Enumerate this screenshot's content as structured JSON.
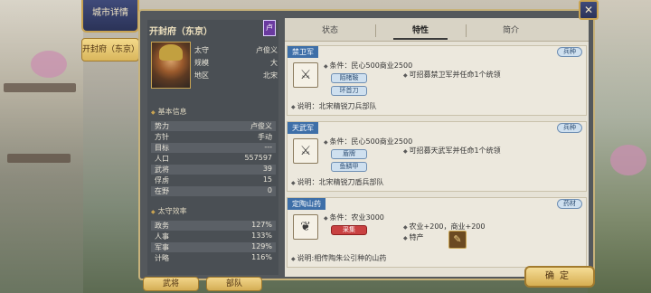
{
  "window": {
    "title": "城市详情",
    "city_tab": "开封府（东京）"
  },
  "city": {
    "name": "开封府（东京）",
    "flag": "卢",
    "governor_label": "太守",
    "governor": "卢俊义",
    "scale_label": "规模",
    "scale": "大",
    "region_label": "地区",
    "region": "北宋"
  },
  "basic_info": {
    "title": "基本信息",
    "rows": [
      {
        "label": "势力",
        "value": "卢俊义"
      },
      {
        "label": "方针",
        "value": "手动"
      },
      {
        "label": "目标",
        "value": "---"
      },
      {
        "label": "人口",
        "value": "557597"
      },
      {
        "label": "武将",
        "value": "39"
      },
      {
        "label": "俘虏",
        "value": "15"
      },
      {
        "label": "在野",
        "value": "0"
      }
    ]
  },
  "efficiency": {
    "title": "太守效率",
    "rows": [
      {
        "label": "政务",
        "value": "127%"
      },
      {
        "label": "人事",
        "value": "133%"
      },
      {
        "label": "军事",
        "value": "129%"
      },
      {
        "label": "计略",
        "value": "116%"
      }
    ]
  },
  "bottom_buttons": {
    "generals": "武将",
    "troops": "部队"
  },
  "tabs": [
    {
      "label": "状态"
    },
    {
      "label": "特性"
    },
    {
      "label": "简介"
    }
  ],
  "cards": [
    {
      "title": "禁卫军",
      "tag": "兵种",
      "condition": "条件：民心500商业2500",
      "chips": [
        "陌楮鞍",
        "环首刀"
      ],
      "effect": "可招募禁卫军并任命1个统领",
      "note": "说明：北宋精锐刀兵部队"
    },
    {
      "title": "天武军",
      "tag": "兵种",
      "condition": "条件：民心500商业2500",
      "chips": [
        "盾牌",
        "鱼鳞甲"
      ],
      "effect": "可招募天武军并任命1个统领",
      "note": "说明：北宋精锐刀盾兵部队"
    },
    {
      "title": "定陶山药",
      "tag": "药材",
      "condition": "条件：农业3000",
      "chips": [
        "采集"
      ],
      "effects": [
        "农业+200，商业+200",
        "特产"
      ],
      "note": "说明:相传陶朱公引种的山药"
    }
  ],
  "confirm_label": "确定",
  "close_icon": "✕"
}
